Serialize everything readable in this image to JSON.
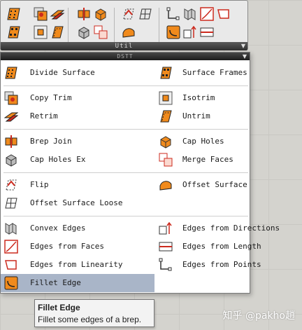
{
  "ribbon": {
    "panel_label": "Util",
    "expand_glyph": "▼",
    "icons": [
      "divide-surface-icon",
      "surface-frames-icon",
      "copy-trim-icon",
      "retrim-icon",
      "isotrim-icon",
      "untrim-icon",
      "brep-join-icon",
      "cap-holes-icon",
      "cap-holes-ex-icon",
      "merge-faces-icon",
      "flip-icon",
      "offset-surface-loose-icon",
      "offset-surface-icon",
      "edges-from-points-icon",
      "convex-edges-icon",
      "edges-from-faces-icon",
      "edges-from-linearity-icon",
      "fillet-edge-icon",
      "edges-from-directions-icon",
      "edges-from-length-icon"
    ]
  },
  "menu": {
    "header_label": "DSTT",
    "expand_glyph": "▼",
    "items": [
      {
        "label": "Divide Surface",
        "icon": "divide-surface-icon"
      },
      {
        "label": "Surface Frames",
        "icon": "surface-frames-icon"
      },
      {
        "label": "Copy Trim",
        "icon": "copy-trim-icon"
      },
      {
        "label": "Isotrim",
        "icon": "isotrim-icon"
      },
      {
        "label": "Retrim",
        "icon": "retrim-icon"
      },
      {
        "label": "Untrim",
        "icon": "untrim-icon"
      },
      {
        "label": "Brep Join",
        "icon": "brep-join-icon"
      },
      {
        "label": "Cap Holes",
        "icon": "cap-holes-icon"
      },
      {
        "label": "Cap Holes Ex",
        "icon": "cap-holes-ex-icon"
      },
      {
        "label": "Merge Faces",
        "icon": "merge-faces-icon"
      },
      {
        "label": "Flip",
        "icon": "flip-icon"
      },
      {
        "label": "Offset Surface",
        "icon": "offset-surface-icon"
      },
      {
        "label": "Offset Surface Loose",
        "icon": "offset-surface-loose-icon"
      },
      {
        "label": "Convex Edges",
        "icon": "convex-edges-icon"
      },
      {
        "label": "Edges from Directions",
        "icon": "edges-from-directions-icon"
      },
      {
        "label": "Edges from Faces",
        "icon": "edges-from-faces-icon"
      },
      {
        "label": "Edges from Length",
        "icon": "edges-from-length-icon"
      },
      {
        "label": "Edges from Linearity",
        "icon": "edges-from-linearity-icon"
      },
      {
        "label": "Edges from Points",
        "icon": "edges-from-points-icon"
      },
      {
        "label": "Fillet Edge",
        "icon": "fillet-edge-icon"
      }
    ],
    "highlighted": "Fillet Edge"
  },
  "tooltip": {
    "title": "Fillet Edge",
    "description": "Fillet some edges of a brep."
  },
  "watermark": "知乎 @pakho趙",
  "colors": {
    "accent_orange": "#f08a1c",
    "icon_red": "#cc2a1e",
    "hover": "#a9b5c8"
  }
}
